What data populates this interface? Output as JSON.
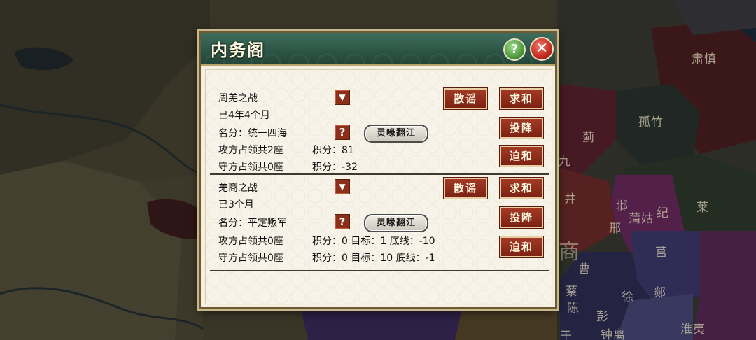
{
  "map": {
    "labels": [
      "肃慎",
      "孤竹",
      "蓟",
      "九",
      "井",
      "邶",
      "蒲姑",
      "纪",
      "莱",
      "邢",
      "商",
      "曹",
      "蔡",
      "莒",
      "陈",
      "徐",
      "郯",
      "彭",
      "钟离",
      "淮夷",
      "于"
    ]
  },
  "dialog": {
    "title": "内务阁",
    "help_label": "?",
    "close_label": "✕"
  },
  "battles": [
    {
      "name": "周羌之战",
      "duration": "已4年4个月",
      "reputation": "名分：统一四海",
      "attacker": "攻方占领共2座",
      "attacker_score": "积分：81",
      "defender": "守方占领共0座",
      "defender_score": "积分：-32",
      "badge": "灵喙翻江",
      "actions": {
        "rumor": "散谣",
        "seek_peace": "求和",
        "surrender": "投降",
        "force_peace": "迫和"
      }
    },
    {
      "name": "羌商之战",
      "duration": "已3个月",
      "reputation": "名分：平定叛军",
      "attacker": "攻方占领共0座",
      "attacker_score": "积分：0  目标：1  底线：-10",
      "defender": "守方占领共0座",
      "defender_score": "积分：0  目标：10  底线：-1",
      "badge": "灵喙翻江",
      "actions": {
        "rumor": "散谣",
        "seek_peace": "求和",
        "surrender": "投降",
        "force_peace": "迫和"
      }
    }
  ],
  "colors": {
    "header": "#2c5546",
    "action_button": "#8c2f1a",
    "dialog_bg": "#f7f3e8"
  }
}
